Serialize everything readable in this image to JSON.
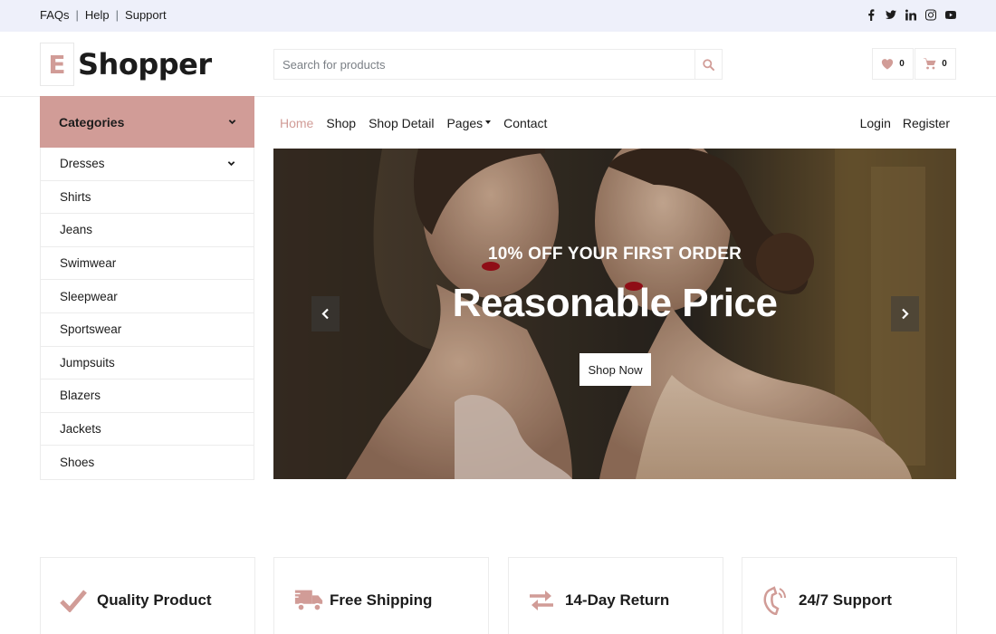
{
  "topbar": {
    "links": [
      "FAQs",
      "Help",
      "Support"
    ],
    "socials": [
      "facebook-icon",
      "twitter-icon",
      "linkedin-icon",
      "instagram-icon",
      "youtube-icon"
    ]
  },
  "header": {
    "logo_letter": "E",
    "logo_text": "Shopper",
    "search_placeholder": "Search for products",
    "wishlist_count": "0",
    "cart_count": "0"
  },
  "categories": {
    "title": "Categories",
    "items": [
      "Dresses",
      "Shirts",
      "Jeans",
      "Swimwear",
      "Sleepwear",
      "Sportswear",
      "Jumpsuits",
      "Blazers",
      "Jackets",
      "Shoes"
    ]
  },
  "nav": {
    "items": [
      "Home",
      "Shop",
      "Shop Detail",
      "Pages",
      "Contact"
    ],
    "active": "Home",
    "login": "Login",
    "register": "Register"
  },
  "hero": {
    "subtitle": "10% OFF YOUR FIRST ORDER",
    "title": "Reasonable Price",
    "button": "Shop Now"
  },
  "features": [
    {
      "icon": "check-icon",
      "label": "Quality Product"
    },
    {
      "icon": "truck-icon",
      "label": "Free Shipping"
    },
    {
      "icon": "exchange-icon",
      "label": "14-Day Return"
    },
    {
      "icon": "phone-icon",
      "label": "24/7 Support"
    }
  ],
  "colors": {
    "accent": "#d19c97",
    "topbar_bg": "#eef0fa",
    "text": "#1c1c1c",
    "border": "#ececec"
  }
}
